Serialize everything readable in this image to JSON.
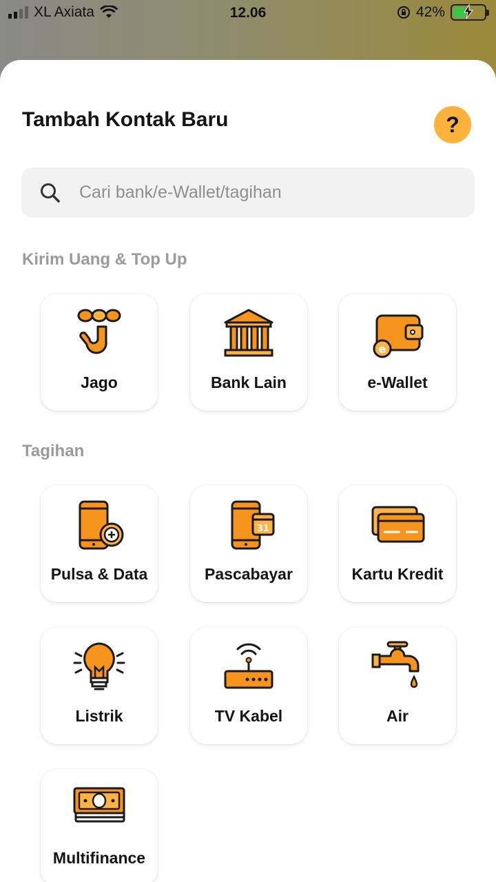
{
  "status_bar": {
    "carrier": "XL Axiata",
    "time": "12.06",
    "battery": "42%",
    "battery_level": 0.42
  },
  "sheet": {
    "title": "Tambah Kontak Baru",
    "help_label": "?"
  },
  "search": {
    "placeholder": "Cari bank/e-Wallet/tagihan"
  },
  "sections": {
    "transfer": {
      "label": "Kirim Uang & Top Up",
      "items": [
        {
          "label": "Jago",
          "icon": "jago-logo-icon"
        },
        {
          "label": "Bank Lain",
          "icon": "bank-icon"
        },
        {
          "label": "e-Wallet",
          "icon": "wallet-icon"
        }
      ]
    },
    "bills": {
      "label": "Tagihan",
      "items": [
        {
          "label": "Pulsa & Data",
          "icon": "phone-topup-icon"
        },
        {
          "label": "Pascabayar",
          "icon": "phone-calendar-icon",
          "calendar_text": "31"
        },
        {
          "label": "Kartu Kredit",
          "icon": "credit-card-icon"
        },
        {
          "label": "Listrik",
          "icon": "lightbulb-icon"
        },
        {
          "label": "TV Kabel",
          "icon": "router-icon"
        },
        {
          "label": "Air",
          "icon": "water-tap-icon"
        },
        {
          "label": "Multifinance",
          "icon": "cash-stack-icon"
        }
      ]
    }
  },
  "colors": {
    "accent": "#fcb23b",
    "orange": "#f7941d",
    "orange_light": "#ffb347",
    "outline": "#1a1a1a"
  }
}
